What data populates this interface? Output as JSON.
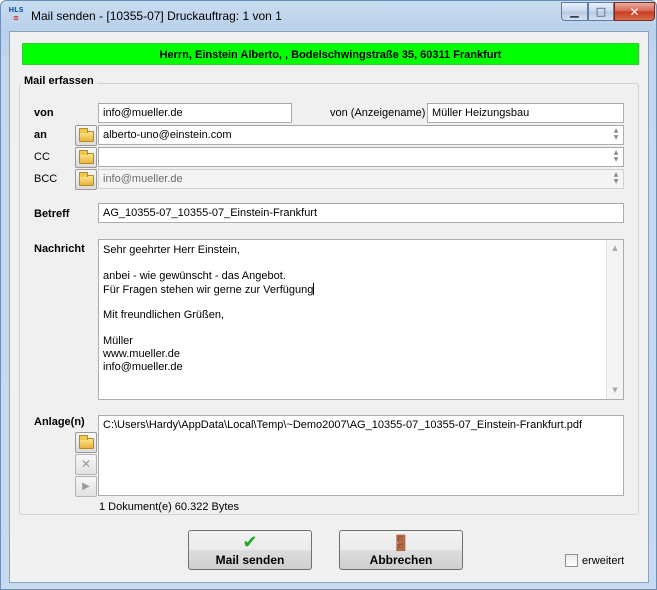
{
  "window": {
    "title": "Mail senden - [10355-07]   Druckauftrag: 1 von 1",
    "app_icon_top": "HLS",
    "app_icon_bottom": "≡",
    "minimize_glyph": "▁",
    "maximize_glyph": "□",
    "close_glyph": "✕"
  },
  "colors": {
    "address_bar": "#00ff00",
    "send_check": "#22aa22",
    "cancel_icon": "#2a56c9"
  },
  "address_bar": {
    "text": "Herrn, Einstein Alberto, , Bodelschwingstraße 35, 60311 Frankfurt"
  },
  "group": {
    "title": "Mail erfassen"
  },
  "from": {
    "label": "von",
    "value": "info@mueller.de",
    "display_name_label": "von (Anzeigename)",
    "display_name_value": "Müller Heizungsbau"
  },
  "to": {
    "label": "an",
    "value": "alberto-uno@einstein.com",
    "browse_icon": "folder-open-icon"
  },
  "cc": {
    "label": "CC",
    "value": ""
  },
  "bcc": {
    "label": "BCC",
    "value": "info@mueller.de"
  },
  "subject": {
    "label": "Betreff",
    "value": "AG_10355-07_10355-07_Einstein-Frankfurt"
  },
  "message": {
    "label": "Nachricht",
    "lines": [
      "Sehr geehrter Herr Einstein,",
      "",
      "anbei - wie gewünscht - das Angebot.",
      "Für Fragen stehen wir gerne zur Verfügung",
      "",
      "Mit freundlichen Grüßen,",
      "",
      "Müller",
      "www.mueller.de",
      "info@mueller.de"
    ]
  },
  "attachments": {
    "label": "Anlage(n)",
    "files": [
      "C:\\Users\\Hardy\\AppData\\Local\\Temp\\~Demo2007\\AG_10355-07_10355-07_Einstein-Frankfurt.pdf"
    ],
    "summary": "1 Dokument(e)    60.322 Bytes",
    "remove_glyph": "✕",
    "open_glyph": "▶"
  },
  "buttons": {
    "send_label": "Mail senden",
    "send_glyph": "✔",
    "cancel_label": "Abbrechen",
    "cancel_glyph": "🚪"
  },
  "extended": {
    "label": "erweitert",
    "checked": false
  }
}
